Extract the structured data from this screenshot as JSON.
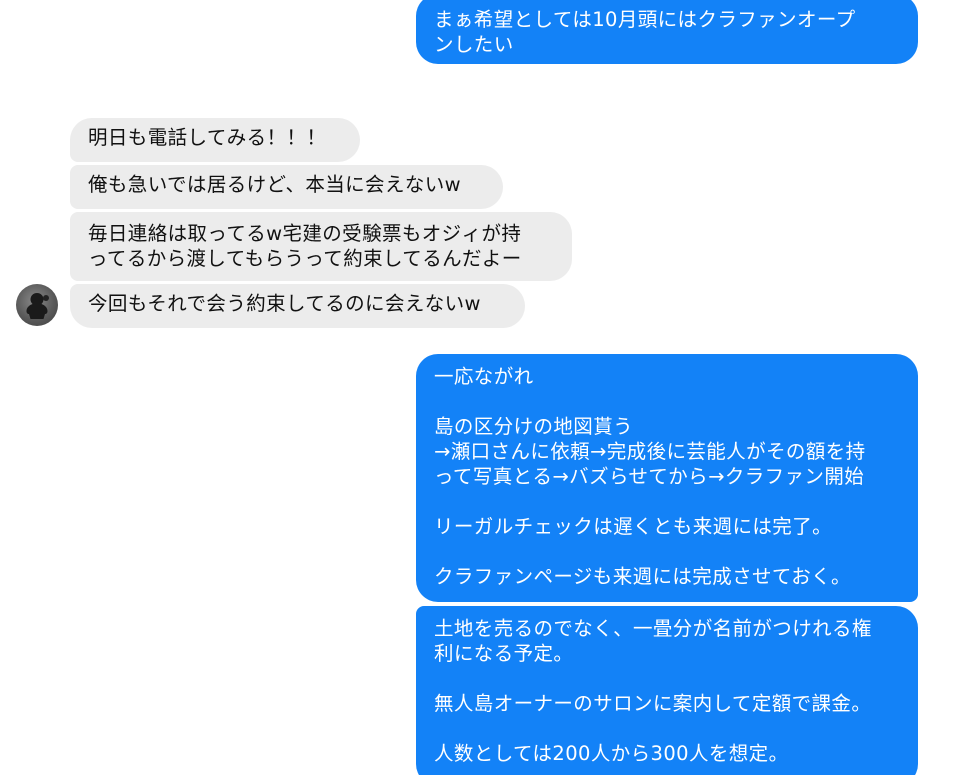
{
  "messages": {
    "m1": "まぁ希望としては10月頭にはクラファンオープ\nンしたい",
    "m2": "明日も電話してみる！！！",
    "m3": "俺も急いでは居るけど、本当に会えないw",
    "m4": "毎日連絡は取ってるw宅建の受験票もオジィが持\nってるから渡してもらうって約束してるんだよー",
    "m5": "今回もそれで会う約束してるのに会えないw",
    "m6": "一応ながれ\n\n島の区分けの地図貰う\n→瀬口さんに依頼→完成後に芸能人がその額を持\nって写真とる→バズらせてから→クラファン開始\n\nリーガルチェックは遅くとも来週には完了。\n\nクラファンページも来週には完成させておく。",
    "m7": "土地を売るのでなく、一畳分が名前がつけれる権\n利になる予定。\n\n無人島オーナーのサロンに案内して定額で課金。\n\n人数としては200人から300人を想定。"
  },
  "colors": {
    "outgoing_bubble": "#1382f7",
    "incoming_bubble": "#ececec"
  },
  "avatar_icon": "contact-avatar-icon"
}
